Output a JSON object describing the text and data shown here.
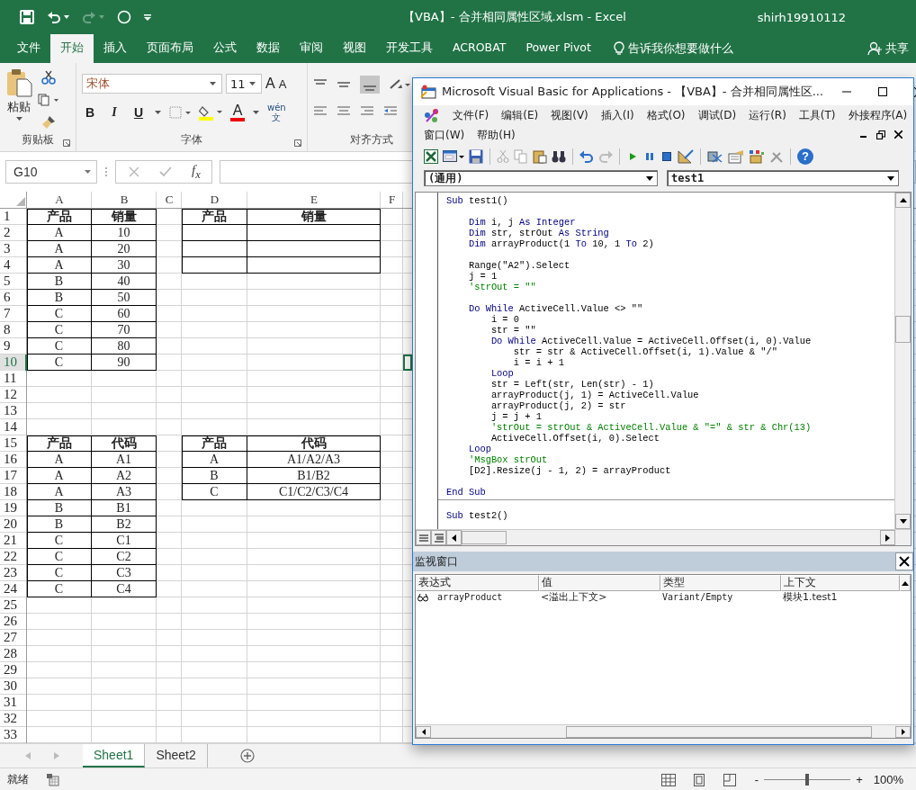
{
  "excel": {
    "title": "【VBA】- 合并相同属性区域.xlsm - Excel",
    "user": "shirh19910112",
    "tabs": [
      {
        "label": "文件",
        "selected": false
      },
      {
        "label": "开始",
        "selected": true
      },
      {
        "label": "插入",
        "selected": false
      },
      {
        "label": "页面布局",
        "selected": false
      },
      {
        "label": "公式",
        "selected": false
      },
      {
        "label": "数据",
        "selected": false
      },
      {
        "label": "审阅",
        "selected": false
      },
      {
        "label": "视图",
        "selected": false
      },
      {
        "label": "开发工具",
        "selected": false
      },
      {
        "label": "ACROBAT",
        "selected": false
      },
      {
        "label": "Power Pivot",
        "selected": false
      }
    ],
    "tell_me": "告诉我你想要做什么",
    "share": "共享",
    "clipboard": {
      "paste": "粘贴",
      "label": "剪贴板"
    },
    "font": {
      "name": "宋体",
      "size": "11",
      "grow": "A",
      "shrink": "A",
      "bold": "B",
      "italic": "I",
      "underline": "U",
      "color_letter": "A",
      "phonetic_top": "wén",
      "phonetic_bottom": "文",
      "label": "字体"
    },
    "alignment": {
      "label": "对齐方式"
    },
    "name_box": "G10",
    "fx": "f$_{x}$",
    "columns": [
      {
        "label": "A",
        "selected": false
      },
      {
        "label": "B",
        "selected": false
      },
      {
        "label": "C",
        "selected": false
      },
      {
        "label": "D",
        "selected": false
      },
      {
        "label": "E",
        "selected": false
      },
      {
        "label": "F",
        "selected": false
      }
    ],
    "rows": [
      {
        "number": "1",
        "selected": false,
        "cells": [
          {
            "text": "产品",
            "bordered": true,
            "bold": true
          },
          {
            "text": "销量",
            "bordered": true,
            "bold": true
          },
          null,
          {
            "text": "产品",
            "bordered": true,
            "bold": true
          },
          {
            "text": "销量",
            "bordered": true,
            "bold": true
          },
          null
        ]
      },
      {
        "number": "2",
        "selected": false,
        "cells": [
          {
            "text": "A",
            "bordered": true
          },
          {
            "text": "10",
            "bordered": true
          },
          null,
          {
            "bordered": true
          },
          {
            "bordered": true
          },
          null
        ]
      },
      {
        "number": "3",
        "selected": false,
        "cells": [
          {
            "text": "A",
            "bordered": true
          },
          {
            "text": "20",
            "bordered": true
          },
          null,
          {
            "bordered": true
          },
          {
            "bordered": true
          },
          null
        ]
      },
      {
        "number": "4",
        "selected": false,
        "cells": [
          {
            "text": "A",
            "bordered": true
          },
          {
            "text": "30",
            "bordered": true
          },
          null,
          {
            "bordered": true
          },
          {
            "bordered": true
          },
          null
        ]
      },
      {
        "number": "5",
        "selected": false,
        "cells": [
          {
            "text": "B",
            "bordered": true
          },
          {
            "text": "40",
            "bordered": true
          },
          null,
          null,
          null,
          null
        ]
      },
      {
        "number": "6",
        "selected": false,
        "cells": [
          {
            "text": "B",
            "bordered": true
          },
          {
            "text": "50",
            "bordered": true
          },
          null,
          null,
          null,
          null
        ]
      },
      {
        "number": "7",
        "selected": false,
        "cells": [
          {
            "text": "C",
            "bordered": true
          },
          {
            "text": "60",
            "bordered": true
          },
          null,
          null,
          null,
          null
        ]
      },
      {
        "number": "8",
        "selected": false,
        "cells": [
          {
            "text": "C",
            "bordered": true
          },
          {
            "text": "70",
            "bordered": true
          },
          null,
          null,
          null,
          null
        ]
      },
      {
        "number": "9",
        "selected": false,
        "cells": [
          {
            "text": "C",
            "bordered": true
          },
          {
            "text": "80",
            "bordered": true
          },
          null,
          null,
          null,
          null
        ]
      },
      {
        "number": "10",
        "selected": true,
        "cells": [
          {
            "text": "C",
            "bordered": true
          },
          {
            "text": "90",
            "bordered": true
          },
          null,
          null,
          null,
          null
        ]
      },
      {
        "number": "11",
        "selected": false
      },
      {
        "number": "12",
        "selected": false
      },
      {
        "number": "13",
        "selected": false
      },
      {
        "number": "14",
        "selected": false
      },
      {
        "number": "15",
        "selected": false,
        "cells": [
          {
            "text": "产品",
            "bordered": true,
            "bold": true
          },
          {
            "text": "代码",
            "bordered": true,
            "bold": true
          },
          null,
          {
            "text": "产品",
            "bordered": true,
            "bold": true
          },
          {
            "text": "代码",
            "bordered": true,
            "bold": true
          },
          null
        ]
      },
      {
        "number": "16",
        "selected": false,
        "cells": [
          {
            "text": "A",
            "bordered": true
          },
          {
            "text": "A1",
            "bordered": true
          },
          null,
          {
            "text": "A",
            "bordered": true
          },
          {
            "text": "A1/A2/A3",
            "bordered": true
          },
          null
        ]
      },
      {
        "number": "17",
        "selected": false,
        "cells": [
          {
            "text": "A",
            "bordered": true
          },
          {
            "text": "A2",
            "bordered": true
          },
          null,
          {
            "text": "B",
            "bordered": true
          },
          {
            "text": "B1/B2",
            "bordered": true
          },
          null
        ]
      },
      {
        "number": "18",
        "selected": false,
        "cells": [
          {
            "text": "A",
            "bordered": true
          },
          {
            "text": "A3",
            "bordered": true
          },
          null,
          {
            "text": "C",
            "bordered": true
          },
          {
            "text": "C1/C2/C3/C4",
            "bordered": true
          },
          null
        ]
      },
      {
        "number": "19",
        "selected": false,
        "cells": [
          {
            "text": "B",
            "bordered": true
          },
          {
            "text": "B1",
            "bordered": true
          },
          null,
          null,
          null,
          null
        ]
      },
      {
        "number": "20",
        "selected": false,
        "cells": [
          {
            "text": "B",
            "bordered": true
          },
          {
            "text": "B2",
            "bordered": true
          },
          null,
          null,
          null,
          null
        ]
      },
      {
        "number": "21",
        "selected": false,
        "cells": [
          {
            "text": "C",
            "bordered": true
          },
          {
            "text": "C1",
            "bordered": true
          },
          null,
          null,
          null,
          null
        ]
      },
      {
        "number": "22",
        "selected": false,
        "cells": [
          {
            "text": "C",
            "bordered": true
          },
          {
            "text": "C2",
            "bordered": true
          },
          null,
          null,
          null,
          null
        ]
      },
      {
        "number": "23",
        "selected": false,
        "cells": [
          {
            "text": "C",
            "bordered": true
          },
          {
            "text": "C3",
            "bordered": true
          },
          null,
          null,
          null,
          null
        ]
      },
      {
        "number": "24",
        "selected": false,
        "cells": [
          {
            "text": "C",
            "bordered": true
          },
          {
            "text": "C4",
            "bordered": true
          },
          null,
          null,
          null,
          null
        ]
      },
      {
        "number": "25",
        "selected": false
      },
      {
        "number": "26",
        "selected": false
      },
      {
        "number": "27",
        "selected": false
      },
      {
        "number": "28",
        "selected": false
      },
      {
        "number": "29",
        "selected": false
      },
      {
        "number": "30",
        "selected": false
      },
      {
        "number": "31",
        "selected": false
      },
      {
        "number": "32",
        "selected": false
      },
      {
        "number": "33",
        "selected": false
      }
    ],
    "sheets": [
      {
        "label": "Sheet1",
        "selected": true
      },
      {
        "label": "Sheet2",
        "selected": false
      }
    ],
    "status": "就绪",
    "zoom_minus": "-",
    "zoom_plus": "+",
    "zoom_slider": {
      "level": 0.5
    },
    "zoom": "100%"
  },
  "vba": {
    "title": "Microsoft Visual Basic for Applications - 【VBA】- 合并相同属性区...",
    "menu_rows": [
      {
        "items": [
          "文件(F)",
          "编辑(E)",
          "视图(V)",
          "插入(I)",
          "格式(O)",
          "调试(D)",
          "运行(R)",
          "工具(T)",
          "外接程序(A)"
        ]
      },
      {
        "items": [
          "窗口(W)",
          "帮助(H)"
        ]
      }
    ],
    "help": "?",
    "object_box": "(通用)",
    "procedure_box": "test1",
    "code": [
      {
        "kind": "code",
        "tokens": [
          {
            "kind": "keyword",
            "text": "Sub"
          },
          {
            "kind": "plain",
            "text": " test1()"
          }
        ]
      },
      {
        "kind": "blank"
      },
      {
        "kind": "code",
        "tokens": [
          {
            "kind": "keyword",
            "text": "    Dim"
          },
          {
            "kind": "plain",
            "text": " i, j "
          },
          {
            "kind": "keyword",
            "text": "As Integer"
          }
        ]
      },
      {
        "kind": "code",
        "tokens": [
          {
            "kind": "keyword",
            "text": "    Dim"
          },
          {
            "kind": "plain",
            "text": " str, strOut "
          },
          {
            "kind": "keyword",
            "text": "As String"
          }
        ]
      },
      {
        "kind": "code",
        "tokens": [
          {
            "kind": "keyword",
            "text": "    Dim"
          },
          {
            "kind": "plain",
            "text": " arrayProduct(1 "
          },
          {
            "kind": "keyword",
            "text": "To"
          },
          {
            "kind": "plain",
            "text": " 10, 1 "
          },
          {
            "kind": "keyword",
            "text": "To"
          },
          {
            "kind": "plain",
            "text": " 2)"
          }
        ]
      },
      {
        "kind": "blank"
      },
      {
        "kind": "code",
        "tokens": [
          {
            "kind": "plain",
            "text": "    Range(\"A2\").Select"
          }
        ]
      },
      {
        "kind": "code",
        "tokens": [
          {
            "kind": "plain",
            "text": "    j = 1"
          }
        ]
      },
      {
        "kind": "code",
        "tokens": [
          {
            "kind": "comment",
            "text": "    'strOut = \"\""
          }
        ]
      },
      {
        "kind": "blank"
      },
      {
        "kind": "code",
        "tokens": [
          {
            "kind": "keyword",
            "text": "    Do While"
          },
          {
            "kind": "plain",
            "text": " ActiveCell.Value <> \"\""
          }
        ]
      },
      {
        "kind": "code",
        "tokens": [
          {
            "kind": "plain",
            "text": "        i = 0"
          }
        ]
      },
      {
        "kind": "code",
        "tokens": [
          {
            "kind": "plain",
            "text": "        str = \"\""
          }
        ]
      },
      {
        "kind": "code",
        "tokens": [
          {
            "kind": "keyword",
            "text": "        Do While"
          },
          {
            "kind": "plain",
            "text": " ActiveCell.Value = ActiveCell.Offset(i, 0).Value"
          }
        ]
      },
      {
        "kind": "code",
        "tokens": [
          {
            "kind": "plain",
            "text": "            str = str & ActiveCell.Offset(i, 1).Value & \"/\""
          }
        ]
      },
      {
        "kind": "code",
        "tokens": [
          {
            "kind": "plain",
            "text": "            i = i + 1"
          }
        ]
      },
      {
        "kind": "code",
        "tokens": [
          {
            "kind": "keyword",
            "text": "        Loop"
          }
        ]
      },
      {
        "kind": "code",
        "tokens": [
          {
            "kind": "plain",
            "text": "        str = Left(str, Len(str) - 1)"
          }
        ]
      },
      {
        "kind": "code",
        "tokens": [
          {
            "kind": "plain",
            "text": "        arrayProduct(j, 1) = ActiveCell.Value"
          }
        ]
      },
      {
        "kind": "code",
        "tokens": [
          {
            "kind": "plain",
            "text": "        arrayProduct(j, 2) = str"
          }
        ]
      },
      {
        "kind": "code",
        "tokens": [
          {
            "kind": "plain",
            "text": "        j = j + 1"
          }
        ]
      },
      {
        "kind": "code",
        "tokens": [
          {
            "kind": "comment",
            "text": "        'strOut = strOut & ActiveCell.Value & \"=\" & str & Chr(13)"
          }
        ]
      },
      {
        "kind": "code",
        "tokens": [
          {
            "kind": "plain",
            "text": "        ActiveCell.Offset(i, 0).Select"
          }
        ]
      },
      {
        "kind": "code",
        "tokens": [
          {
            "kind": "keyword",
            "text": "    Loop"
          }
        ]
      },
      {
        "kind": "code",
        "tokens": [
          {
            "kind": "comment",
            "text": "    'MsgBox strOut"
          }
        ]
      },
      {
        "kind": "code",
        "tokens": [
          {
            "kind": "plain",
            "text": "    [D2].Resize(j - 1, 2) = arrayProduct"
          }
        ]
      },
      {
        "kind": "blank"
      },
      {
        "kind": "code",
        "tokens": [
          {
            "kind": "keyword",
            "text": "End Sub"
          }
        ]
      },
      {
        "kind": "separator"
      },
      {
        "kind": "blank"
      },
      {
        "kind": "code",
        "tokens": [
          {
            "kind": "keyword",
            "text": "Sub"
          },
          {
            "kind": "plain",
            "text": " test2()"
          }
        ]
      }
    ],
    "watch": {
      "title": "监视窗口",
      "columns": [
        "表达式",
        "值",
        "类型",
        "上下文"
      ],
      "rows": [
        {
          "expression": "arrayProduct",
          "value": "<溢出上下文>",
          "type": "Variant/Empty",
          "context": "模块1.test1"
        }
      ]
    }
  }
}
